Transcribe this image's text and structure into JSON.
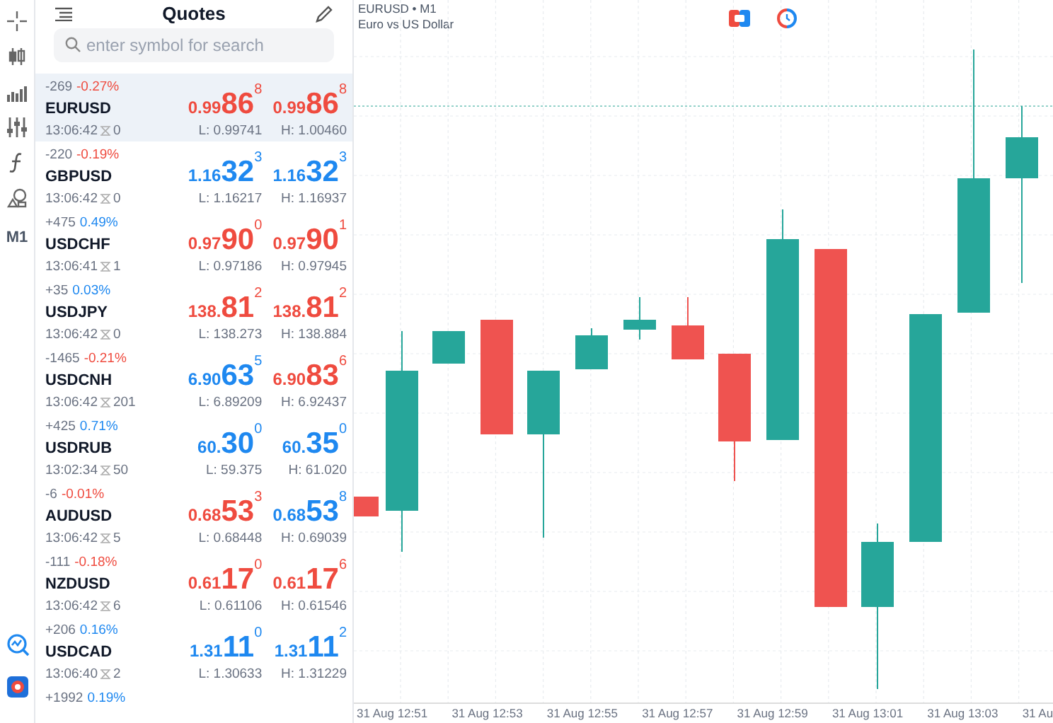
{
  "toolbar": {
    "timeframe": "M1"
  },
  "quotes": {
    "title": "Quotes",
    "search": {
      "placeholder": "enter symbol for search"
    },
    "rows": [
      {
        "symbol": "EURUSD",
        "selected": true,
        "change": "-269",
        "percent": "-0.27%",
        "color": "#ef4b3f",
        "time": "13:06:42",
        "spread": "0",
        "bid": {
          "prefix": "0.99",
          "digits": "86",
          "sup": "8",
          "color": "#ef4b3f"
        },
        "ask": {
          "prefix": "0.99",
          "digits": "86",
          "sup": "8",
          "color": "#ef4b3f"
        },
        "low": "L: 0.99741",
        "high": "H: 1.00460"
      },
      {
        "symbol": "GBPUSD",
        "selected": false,
        "change": "-220",
        "percent": "-0.19%",
        "color": "#ef4b3f",
        "time": "13:06:42",
        "spread": "0",
        "bid": {
          "prefix": "1.16",
          "digits": "32",
          "sup": "3",
          "color": "#1e88f0"
        },
        "ask": {
          "prefix": "1.16",
          "digits": "32",
          "sup": "3",
          "color": "#1e88f0"
        },
        "low": "L: 1.16217",
        "high": "H: 1.16937"
      },
      {
        "symbol": "USDCHF",
        "selected": false,
        "change": "+475",
        "percent": "0.49%",
        "color": "#1e88f0",
        "time": "13:06:41",
        "spread": "1",
        "bid": {
          "prefix": "0.97",
          "digits": "90",
          "sup": "0",
          "color": "#ef4b3f"
        },
        "ask": {
          "prefix": "0.97",
          "digits": "90",
          "sup": "1",
          "color": "#ef4b3f"
        },
        "low": "L: 0.97186",
        "high": "H: 0.97945"
      },
      {
        "symbol": "USDJPY",
        "selected": false,
        "change": "+35",
        "percent": "0.03%",
        "color": "#1e88f0",
        "time": "13:06:42",
        "spread": "0",
        "bid": {
          "prefix": "138.",
          "digits": "81",
          "sup": "2",
          "color": "#ef4b3f"
        },
        "ask": {
          "prefix": "138.",
          "digits": "81",
          "sup": "2",
          "color": "#ef4b3f"
        },
        "low": "L: 138.273",
        "high": "H: 138.884"
      },
      {
        "symbol": "USDCNH",
        "selected": false,
        "change": "-1465",
        "percent": "-0.21%",
        "color": "#ef4b3f",
        "time": "13:06:42",
        "spread": "201",
        "bid": {
          "prefix": "6.90",
          "digits": "63",
          "sup": "5",
          "color": "#1e88f0"
        },
        "ask": {
          "prefix": "6.90",
          "digits": "83",
          "sup": "6",
          "color": "#ef4b3f"
        },
        "low": "L: 6.89209",
        "high": "H: 6.92437"
      },
      {
        "symbol": "USDRUB",
        "selected": false,
        "change": "+425",
        "percent": "0.71%",
        "color": "#1e88f0",
        "time": "13:02:34",
        "spread": "50",
        "bid": {
          "prefix": "60.",
          "digits": "30",
          "sup": "0",
          "color": "#1e88f0"
        },
        "ask": {
          "prefix": "60.",
          "digits": "35",
          "sup": "0",
          "color": "#1e88f0"
        },
        "low": "L: 59.375",
        "high": "H: 61.020"
      },
      {
        "symbol": "AUDUSD",
        "selected": false,
        "change": "-6",
        "percent": "-0.01%",
        "color": "#ef4b3f",
        "time": "13:06:42",
        "spread": "5",
        "bid": {
          "prefix": "0.68",
          "digits": "53",
          "sup": "3",
          "color": "#ef4b3f"
        },
        "ask": {
          "prefix": "0.68",
          "digits": "53",
          "sup": "8",
          "color": "#1e88f0"
        },
        "low": "L: 0.68448",
        "high": "H: 0.69039"
      },
      {
        "symbol": "NZDUSD",
        "selected": false,
        "change": "-111",
        "percent": "-0.18%",
        "color": "#ef4b3f",
        "time": "13:06:42",
        "spread": "6",
        "bid": {
          "prefix": "0.61",
          "digits": "17",
          "sup": "0",
          "color": "#ef4b3f"
        },
        "ask": {
          "prefix": "0.61",
          "digits": "17",
          "sup": "6",
          "color": "#ef4b3f"
        },
        "low": "L: 0.61106",
        "high": "H: 0.61546"
      },
      {
        "symbol": "USDCAD",
        "selected": false,
        "change": "+206",
        "percent": "0.16%",
        "color": "#1e88f0",
        "time": "13:06:40",
        "spread": "2",
        "bid": {
          "prefix": "1.31",
          "digits": "11",
          "sup": "0",
          "color": "#1e88f0"
        },
        "ask": {
          "prefix": "1.31",
          "digits": "11",
          "sup": "2",
          "color": "#1e88f0"
        },
        "low": "L: 1.30633",
        "high": "H: 1.31229"
      },
      {
        "change": "+1992",
        "percent": "0.19%",
        "color": "#1e88f0"
      }
    ]
  },
  "chart": {
    "title": "EURUSD • M1",
    "subtitle": "Euro vs US Dollar",
    "time_labels": [
      "31 Aug 12:51",
      "31 Aug 12:53",
      "31 Aug 12:55",
      "31 Aug 12:57",
      "31 Aug 12:59",
      "31 Aug 13:01",
      "31 Aug 13:03",
      "31 Au"
    ]
  }
}
